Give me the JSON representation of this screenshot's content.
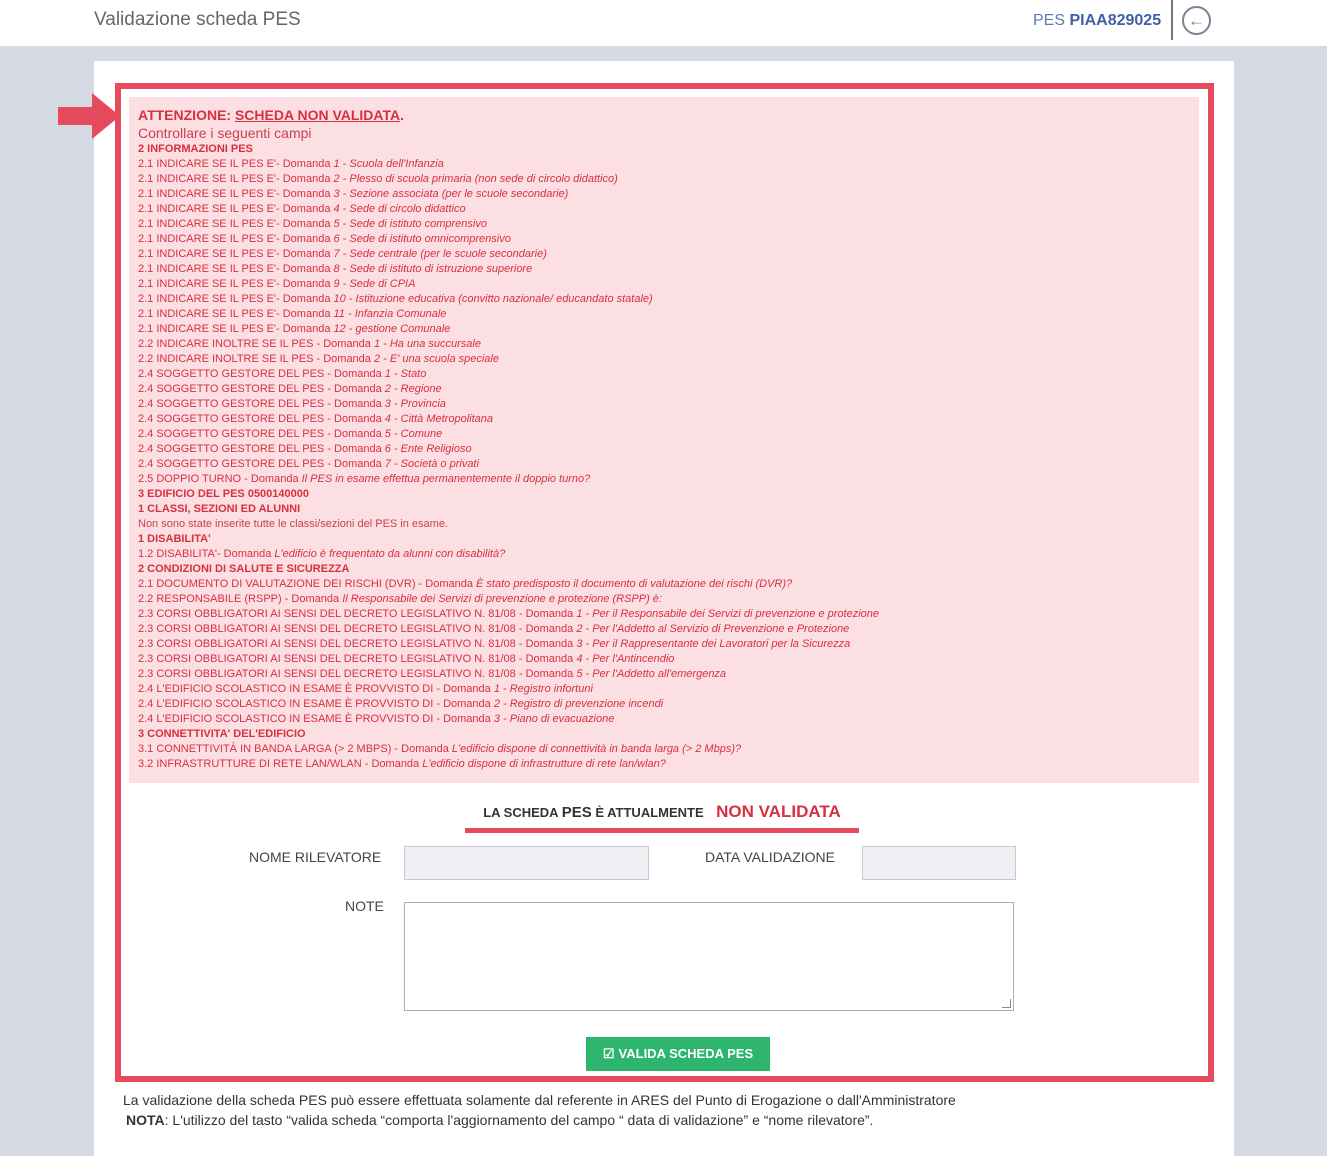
{
  "header": {
    "title": "Validazione scheda PES",
    "pes_label": "PES",
    "pes_code": "PIAA829025",
    "back_icon": "arrow-left-circle-icon"
  },
  "alert": {
    "attention": "ATTENZIONE:",
    "status_text": "SCHEDA NON VALIDATA",
    "dot": ".",
    "subtitle": "Controllare i seguenti campi",
    "lines": [
      {
        "type": "sec",
        "text": "2 INFORMAZIONI PES"
      },
      {
        "type": "item",
        "text": "2.1 INDICARE SE IL PES E'- Domanda ",
        "italic": "1 - Scuola dell'Infanzia"
      },
      {
        "type": "item",
        "text": "2.1 INDICARE SE IL PES E'- Domanda ",
        "italic": "2 - Plesso di scuola primaria (non sede di circolo didattico)"
      },
      {
        "type": "item",
        "text": "2.1 INDICARE SE IL PES E'- Domanda ",
        "italic": "3 - Sezione associata (per le scuole secondarie)"
      },
      {
        "type": "item",
        "text": "2.1 INDICARE SE IL PES E'- Domanda ",
        "italic": "4 - Sede di circolo didattico"
      },
      {
        "type": "item",
        "text": "2.1 INDICARE SE IL PES E'- Domanda ",
        "italic": "5 - Sede di istituto comprensivo"
      },
      {
        "type": "item",
        "text": "2.1 INDICARE SE IL PES E'- Domanda ",
        "italic": "6 - Sede di istituto omnicomprensivo"
      },
      {
        "type": "item",
        "text": "2.1 INDICARE SE IL PES E'- Domanda ",
        "italic": "7 - Sede centrale (per le scuole secondarie)"
      },
      {
        "type": "item",
        "text": "2.1 INDICARE SE IL PES E'- Domanda ",
        "italic": "8 - Sede di istituto di istruzione superiore"
      },
      {
        "type": "item",
        "text": "2.1 INDICARE SE IL PES E'- Domanda ",
        "italic": "9 - Sede di CPIA"
      },
      {
        "type": "item",
        "text": "2.1 INDICARE SE IL PES E'- Domanda ",
        "italic": "10 - Istituzione educativa (convitto nazionale/ educandato statale)"
      },
      {
        "type": "item",
        "text": "2.1 INDICARE SE IL PES E'- Domanda ",
        "italic": "11 - Infanzia Comunale"
      },
      {
        "type": "item",
        "text": "2.1 INDICARE SE IL PES E'- Domanda ",
        "italic": "12 - gestione Comunale"
      },
      {
        "type": "item",
        "text": "2.2 INDICARE INOLTRE SE IL PES - Domanda ",
        "italic": "1 - Ha una succursale"
      },
      {
        "type": "item",
        "text": "2.2 INDICARE INOLTRE SE IL PES - Domanda ",
        "italic": "2 - E' una scuola speciale"
      },
      {
        "type": "item",
        "text": "2.4 SOGGETTO GESTORE DEL PES - Domanda ",
        "italic": "1 - Stato"
      },
      {
        "type": "item",
        "text": "2.4 SOGGETTO GESTORE DEL PES - Domanda ",
        "italic": "2 - Regione"
      },
      {
        "type": "item",
        "text": "2.4 SOGGETTO GESTORE DEL PES - Domanda ",
        "italic": "3 - Provincia"
      },
      {
        "type": "item",
        "text": "2.4 SOGGETTO GESTORE DEL PES - Domanda ",
        "italic": "4 - Città Metropolitana"
      },
      {
        "type": "item",
        "text": "2.4 SOGGETTO GESTORE DEL PES - Domanda ",
        "italic": "5 - Comune"
      },
      {
        "type": "item",
        "text": "2.4 SOGGETTO GESTORE DEL PES - Domanda ",
        "italic": "6 - Ente Religioso"
      },
      {
        "type": "item",
        "text": "2.4 SOGGETTO GESTORE DEL PES - Domanda ",
        "italic": "7 - Società o privati"
      },
      {
        "type": "item",
        "text": "2.5 DOPPIO TURNO - Domanda ",
        "italic": "Il PES in esame effettua permanentemente il doppio turno?"
      },
      {
        "type": "sec",
        "text": "3 EDIFICIO DEL PES 0500140000"
      },
      {
        "type": "sec",
        "text": "1 CLASSI, SEZIONI ED ALUNNI"
      },
      {
        "type": "plain",
        "text": "Non sono state inserite tutte le classi/sezioni del PES in esame."
      },
      {
        "type": "sec",
        "text": "1 DISABILITA'"
      },
      {
        "type": "item",
        "text": "1.2 DISABILITA'- Domanda ",
        "italic": "L'edificio è frequentato da alunni con disabilità?"
      },
      {
        "type": "sec",
        "text": "2 CONDIZIONI DI SALUTE E SICUREZZA"
      },
      {
        "type": "item",
        "text": "2.1 DOCUMENTO DI VALUTAZIONE DEI RISCHI (DVR) - Domanda ",
        "italic": "È stato predisposto il documento di valutazione dei rischi (DVR)?"
      },
      {
        "type": "item",
        "text": "2.2 RESPONSABILE (RSPP) - Domanda ",
        "italic": "Il Responsabile dei Servizi di prevenzione e protezione (RSPP) è:"
      },
      {
        "type": "item",
        "text": "2.3 CORSI OBBLIGATORI AI SENSI DEL DECRETO LEGISLATIVO N. 81/08 - Domanda ",
        "italic": "1 - Per il Responsabile dei Servizi di prevenzione e protezione"
      },
      {
        "type": "item",
        "text": "2.3 CORSI OBBLIGATORI AI SENSI DEL DECRETO LEGISLATIVO N. 81/08 - Domanda ",
        "italic": "2 - Per l'Addetto al Servizio di Prevenzione e Protezione"
      },
      {
        "type": "item",
        "text": "2.3 CORSI OBBLIGATORI AI SENSI DEL DECRETO LEGISLATIVO N. 81/08 - Domanda ",
        "italic": "3 - Per il Rappresentante dei Lavoratori per la Sicurezza"
      },
      {
        "type": "item",
        "text": "2.3 CORSI OBBLIGATORI AI SENSI DEL DECRETO LEGISLATIVO N. 81/08 - Domanda ",
        "italic": "4 - Per l'Antincendio"
      },
      {
        "type": "item",
        "text": "2.3 CORSI OBBLIGATORI AI SENSI DEL DECRETO LEGISLATIVO N. 81/08 - Domanda ",
        "italic": "5 - Per l'Addetto all'emergenza"
      },
      {
        "type": "item",
        "text": "2.4 L'EDIFICIO SCOLASTICO IN ESAME È PROVVISTO DI - Domanda ",
        "italic": "1 - Registro infortuni"
      },
      {
        "type": "item",
        "text": "2.4 L'EDIFICIO SCOLASTICO IN ESAME È PROVVISTO DI - Domanda ",
        "italic": "2 - Registro di prevenzione incendi"
      },
      {
        "type": "item",
        "text": "2.4 L'EDIFICIO SCOLASTICO IN ESAME È PROVVISTO DI - Domanda ",
        "italic": "3 - Piano di evacuazione"
      },
      {
        "type": "sec",
        "text": "3 CONNETTIVITA' DEL'EDIFICIO"
      },
      {
        "type": "item",
        "text": "3.1 CONNETTIVITÀ IN BANDA LARGA (> 2 MBPS) - Domanda ",
        "italic": "L'edificio dispone di connettività in banda larga (> 2 Mbps)?"
      },
      {
        "type": "item",
        "text": "3.2 INFRASTRUTTURE DI RETE LAN/WLAN - Domanda ",
        "italic": "L'edificio dispone di infrastrutture di rete lan/wlan?"
      }
    ]
  },
  "status": {
    "prefix": "LA SCHEDA ",
    "pes": "PES",
    "suffix": " È ATTUALMENTE",
    "value": "NON VALIDATA"
  },
  "form": {
    "nome_label": "NOME RILEVATORE",
    "nome_value": "",
    "data_label": "DATA VALIDAZIONE",
    "data_value": "",
    "note_label": "NOTE",
    "note_value": ""
  },
  "button": {
    "icon": "check-square-icon",
    "label": "VALIDA SCHEDA PES"
  },
  "footer": {
    "line1": "La validazione della scheda PES può essere effettuata solamente dal referente in ARES del Punto di Erogazione o dall'Amministratore",
    "nota_label": "NOTA",
    "nota_text": ": L'utilizzo del tasto “valida scheda “comporta l'aggiornamento del campo “ data di validazione” e “nome rilevatore”."
  }
}
